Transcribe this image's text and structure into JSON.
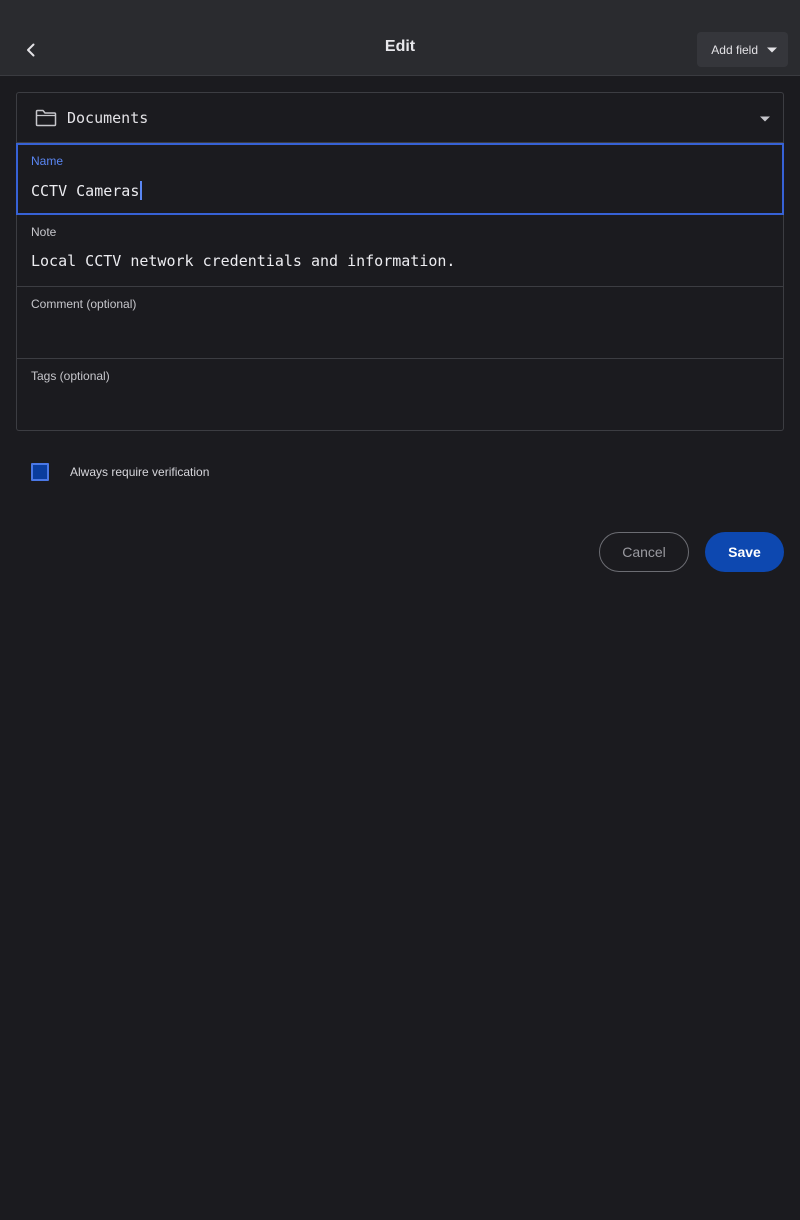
{
  "app_bar": {
    "title": "Edit",
    "back_icon": "chevron-left-icon",
    "add_field_label": "Add field",
    "add_field_icon": "caret-down-icon"
  },
  "folder": {
    "icon": "folder-icon",
    "selected": "Documents",
    "dropdown_icon": "caret-down-icon"
  },
  "fields": {
    "name": {
      "label": "Name",
      "value": "CCTV Cameras"
    },
    "note": {
      "label": "Note",
      "value": "Local CCTV network credentials and information."
    },
    "comment": {
      "label": "Comment (optional)",
      "value": ""
    },
    "tags": {
      "label": "Tags (optional)",
      "value": ""
    }
  },
  "verification": {
    "label": "Always require verification",
    "checked": true
  },
  "actions": {
    "cancel_label": "Cancel",
    "save_label": "Save"
  },
  "colors": {
    "background": "#1b1b1f",
    "app_bar": "#2a2b2f",
    "accent": "#3762d6",
    "save_button": "#0d48b0"
  }
}
